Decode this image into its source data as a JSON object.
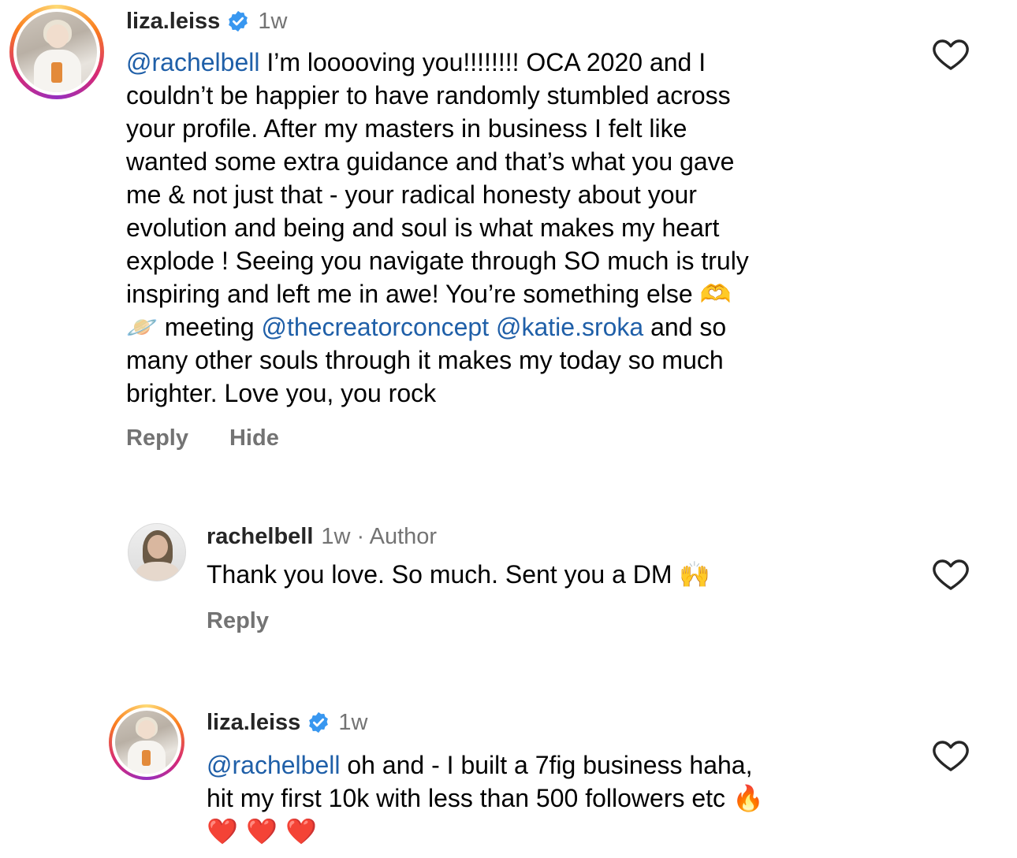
{
  "comments": [
    {
      "username": "liza.leiss",
      "time": "1w",
      "mention": "@rachelbell",
      "lines": [
        " I’m looooving you!!!!!!!! OCA 2020 and I",
        "couldn’t be happier to have randomly stumbled across",
        "your profile. After my masters in business I felt like",
        "wanted some extra guidance and that’s what you gave",
        "me & not just that - your radical honesty about your",
        "evolution and being and soul is what makes my heart",
        "explode ! Seeing you navigate through SO much is truly",
        "inspiring and left me in awe! You’re something else 🫶"
      ],
      "line9_emoji": "🪐",
      "line9_pre": " meeting ",
      "mention2": "@thecreatorconcept",
      "mention3": "@katie.sroka",
      "line9_post": " and so",
      "line10": "many other souls through it makes my today so much",
      "line11": "brighter. Love you, you rock",
      "reply_label": "Reply",
      "hide_label": "Hide"
    },
    {
      "username": "rachelbell",
      "time": "1w",
      "author_label": "· Author",
      "text": "Thank you love. So much. Sent you a DM 🙌",
      "reply_label": "Reply"
    },
    {
      "username": "liza.leiss",
      "time": "1w",
      "mention": "@rachelbell",
      "line1": " oh and - I built a 7fig business haha,",
      "line2": "hit my first 10k with less than 500 followers etc 🔥",
      "line3": "❤️ ❤️ ❤️"
    }
  ],
  "icons": {
    "verified": "verified-badge-icon",
    "heart": "heart-outline-icon"
  },
  "colors": {
    "mention": "#1f5fa8",
    "muted": "#737373",
    "verified_blue": "#3897f0"
  }
}
